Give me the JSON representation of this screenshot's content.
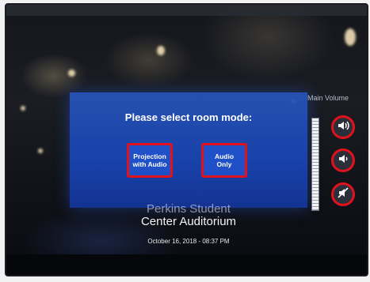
{
  "panel": {
    "title": "Please select room mode:",
    "buttons": [
      {
        "label": "Projection\nwith Audio"
      },
      {
        "label": "Audio\nOnly"
      }
    ]
  },
  "volume": {
    "label": "Main Volume",
    "up_icon": "volume-up-icon",
    "down_icon": "volume-down-icon",
    "mute_icon": "mute-icon"
  },
  "location": {
    "line1": "Perkins Student",
    "line2": "Center Auditorium"
  },
  "datetime": "October 16, 2018 - 08:37 PM",
  "colors": {
    "highlight": "#e1121b",
    "panel_blue": "#2355d2"
  }
}
